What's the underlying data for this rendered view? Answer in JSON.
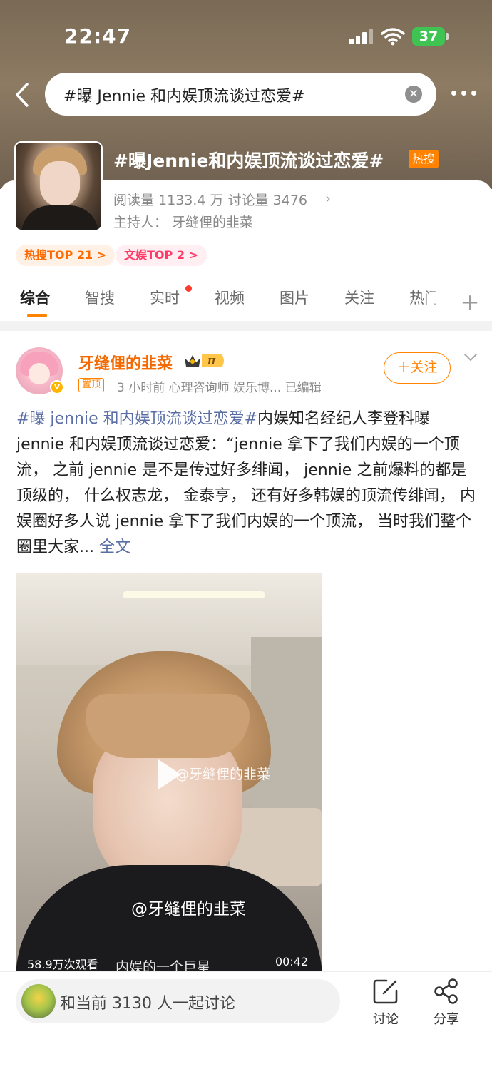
{
  "status_bar": {
    "time": "22:47",
    "battery": "37"
  },
  "search": {
    "query": "#曝 Jennie 和内娱顶流谈过恋爱#"
  },
  "topic": {
    "title": "#曝Jennie和内娱顶流谈过恋爱#",
    "hot_badge": "热搜",
    "stats": "阅读量 1133.4 万  讨论量 3476",
    "host": "主持人：  牙缝俚的韭菜",
    "rank_badges": [
      "热搜TOP 21 >",
      "文娱TOP 2 >"
    ]
  },
  "tabs": [
    "综合",
    "智搜",
    "实时",
    "视频",
    "图片",
    "关注",
    "热门"
  ],
  "post": {
    "author": "牙缝俚的韭菜",
    "pin_label": "置顶",
    "meta": "3 小时前  心理咨询师 娱乐博...  已编辑",
    "follow_label": "＋关注",
    "hashtag": "#曝 jennie 和内娱顶流谈过恋爱#",
    "text": "内娱知名经纪人李登科曝 jennie 和内娱顶流谈过恋爱：“jennie 拿下了我们内娱的一个顶流， 之前 jennie 是不是传过好多绯闻， jennie 之前爆料的都是顶级的， 什么权志龙， 金泰亨， 还有好多韩娱的顶流传绯闻， 内娱圈好多人说 jennie 拿下了我们内娱的一个顶流， 当时我们整个圈里大家...",
    "full_text_link": "全文",
    "video": {
      "watermark": "@牙缝俚的韭菜",
      "subtitle": "@牙缝俚的韭菜",
      "views": "58.9万次观看",
      "caption": "内娱的一个巨星",
      "duration": "00:42"
    }
  },
  "bottom_bar": {
    "discussion_placeholder": "和当前 3130 人一起讨论",
    "discuss_label": "讨论",
    "share_label": "分享"
  },
  "colors": {
    "accent": "#ff8200",
    "hashtag": "#5b6fa6",
    "author": "#f56a00"
  },
  "icons": [
    "back-icon",
    "clear-icon",
    "more-icon",
    "play-icon",
    "edit-icon",
    "share-icon",
    "plus-icon"
  ]
}
